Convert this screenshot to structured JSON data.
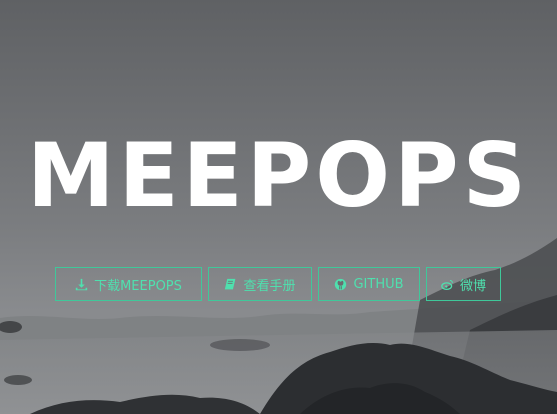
{
  "hero": {
    "title": "MEEPOPS",
    "accent_color": "#4fe0ae"
  },
  "buttons": [
    {
      "label": "下载MEEPOPS",
      "icon": "download-icon"
    },
    {
      "label": "查看手册",
      "icon": "book-icon"
    },
    {
      "label": "GITHUB",
      "icon": "github-icon"
    },
    {
      "label": "微博",
      "icon": "weibo-icon"
    }
  ]
}
